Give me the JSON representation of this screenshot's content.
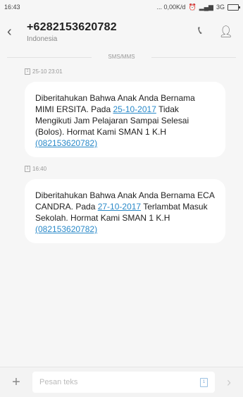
{
  "status_bar": {
    "time": "16:43",
    "indicators": "... 0,00K/d",
    "network": "3G"
  },
  "header": {
    "back_icon": "chevron-left-icon",
    "phone_number": "+6282153620782",
    "country": "Indonesia",
    "call_icon": "phone-icon",
    "contact_icon": "person-icon"
  },
  "channel_label": "SMS/MMS",
  "messages": [
    {
      "timestamp": "25-10 23:01",
      "sim": "1",
      "text_a": "Diberitahukan Bahwa Anak Anda Bernama MIMI ERSITA. Pada ",
      "date_link": "25-10-2017",
      "text_b": " Tidak Mengikuti Jam Pelajaran Sampai Selesai (Bolos). Hormat Kami SMAN 1 K.H ",
      "phone_link": "(082153620782)"
    },
    {
      "timestamp": "16:40",
      "sim": "1",
      "text_a": "Diberitahukan Bahwa Anak Anda Bernama ECA CANDRA. Pada ",
      "date_link": "27-10-2017",
      "text_b": " Terlambat Masuk Sekolah. Hormat Kami SMAN 1 K.H ",
      "phone_link": "(082153620782)"
    }
  ],
  "input_bar": {
    "add_icon": "plus-icon",
    "placeholder": "Pesan teks",
    "sim": "1",
    "send_icon": "send-icon"
  }
}
